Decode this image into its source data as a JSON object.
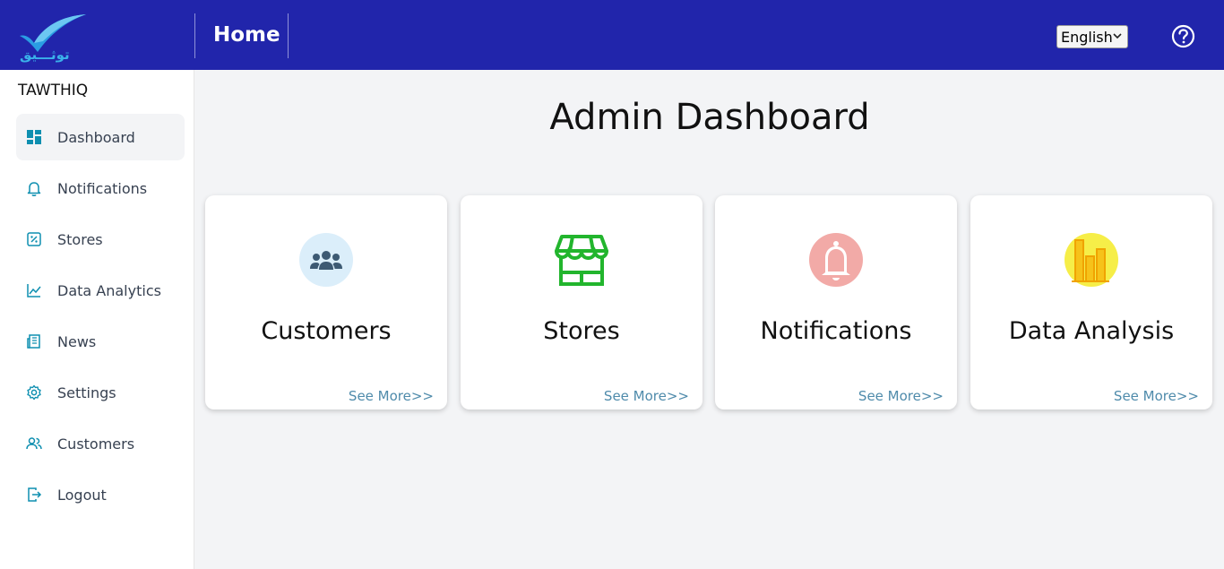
{
  "header": {
    "logo_text": "توثـــيق",
    "title": "Home",
    "language": "English"
  },
  "sidebar": {
    "brand": "TAWTHIQ",
    "items": [
      {
        "label": "Dashboard",
        "icon": "dashboard-icon",
        "active": true
      },
      {
        "label": "Notifications",
        "icon": "bell-icon"
      },
      {
        "label": "Stores",
        "icon": "stores-icon"
      },
      {
        "label": "Data Analytics",
        "icon": "chart-line-icon"
      },
      {
        "label": "News",
        "icon": "news-icon"
      },
      {
        "label": "Settings",
        "icon": "gear-icon"
      },
      {
        "label": "Customers",
        "icon": "users-icon"
      },
      {
        "label": "Logout",
        "icon": "logout-icon"
      }
    ]
  },
  "main": {
    "title": "Admin Dashboard",
    "cards": [
      {
        "title": "Customers",
        "link": "See More>>",
        "icon": "customers-icon"
      },
      {
        "title": "Stores",
        "link": "See More>>",
        "icon": "store-icon"
      },
      {
        "title": "Notifications",
        "link": "See More>>",
        "icon": "notification-bell-icon"
      },
      {
        "title": "Data Analysis",
        "link": "See More>>",
        "icon": "bar-chart-icon"
      }
    ]
  },
  "colors": {
    "header_bg": "#2125ab",
    "accent": "#0e8fb0",
    "link": "#4f8bab"
  }
}
